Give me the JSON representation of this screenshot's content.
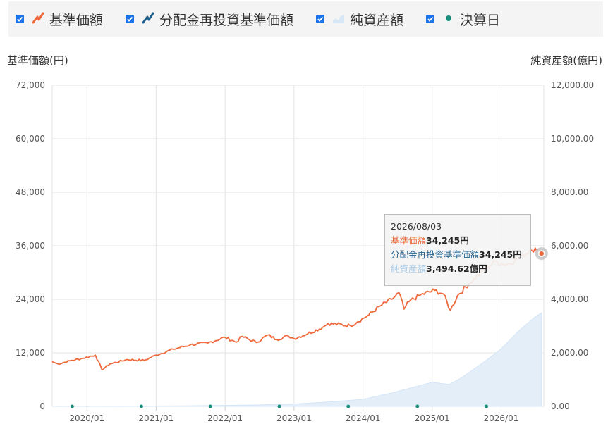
{
  "legend": [
    {
      "label": "基準価額",
      "icon": "nav-line-icon",
      "color": "#ee6a3c",
      "checked": true
    },
    {
      "label": "分配金再投資基準価額",
      "icon": "reinvest-line-icon",
      "color": "#1f5f8b",
      "checked": true
    },
    {
      "label": "純資産額",
      "icon": "area-icon",
      "color": "#c9dff2",
      "checked": true
    },
    {
      "label": "決算日",
      "icon": "dot-icon",
      "color": "#1a8f7e",
      "checked": true
    }
  ],
  "axis_titles": {
    "left": "基準価額(円)",
    "right": "純資産額(億円)"
  },
  "tooltip": {
    "date": "2026/08/03",
    "rows": [
      {
        "label": "基準価額",
        "value": "34,245円",
        "color": "#ee6a3c"
      },
      {
        "label": "分配金再投資基準価額",
        "value": "34,245円",
        "color": "#1f5f8b"
      },
      {
        "label": "純資産額",
        "value": "3,494.62億円",
        "color": "#a9cbe8"
      }
    ]
  },
  "chart_data": {
    "type": "line",
    "x_ticks": [
      "2020/01",
      "2021/01",
      "2022/01",
      "2023/01",
      "2024/01",
      "2025/01",
      "2026/01"
    ],
    "y_left": {
      "ticks": [
        "0",
        "12,000",
        "24,000",
        "36,000",
        "48,000",
        "60,000",
        "72,000"
      ],
      "range": [
        0,
        72000
      ]
    },
    "y_right": {
      "ticks": [
        "0.00",
        "2,000.00",
        "4,000.00",
        "6,000.00",
        "8,000.00",
        "10,000.00",
        "12,000.00"
      ],
      "range": [
        0,
        12000
      ]
    },
    "x_range": [
      "2019-07-01",
      "2026-08-15"
    ],
    "grid": true,
    "series": [
      {
        "name": "基準価額",
        "axis": "left",
        "color": "#ee6a3c",
        "points": [
          [
            "2019-07-01",
            10000
          ],
          [
            "2019-08-01",
            9500
          ],
          [
            "2019-10-01",
            10200
          ],
          [
            "2019-12-01",
            10700
          ],
          [
            "2020-02-15",
            11500
          ],
          [
            "2020-03-20",
            8200
          ],
          [
            "2020-05-01",
            9500
          ],
          [
            "2020-08-01",
            10500
          ],
          [
            "2020-10-30",
            10300
          ],
          [
            "2021-01-01",
            11500
          ],
          [
            "2021-04-01",
            12800
          ],
          [
            "2021-07-01",
            13800
          ],
          [
            "2021-10-01",
            14200
          ],
          [
            "2022-01-01",
            15500
          ],
          [
            "2022-03-01",
            14400
          ],
          [
            "2022-04-01",
            15700
          ],
          [
            "2022-06-15",
            14300
          ],
          [
            "2022-08-15",
            16000
          ],
          [
            "2022-10-01",
            15000
          ],
          [
            "2022-12-01",
            15800
          ],
          [
            "2023-01-01",
            15200
          ],
          [
            "2023-03-15",
            16300
          ],
          [
            "2023-06-01",
            17700
          ],
          [
            "2023-07-01",
            18600
          ],
          [
            "2023-10-25",
            18100
          ],
          [
            "2023-12-01",
            18900
          ],
          [
            "2024-02-01",
            20500
          ],
          [
            "2024-04-01",
            22500
          ],
          [
            "2024-06-01",
            24000
          ],
          [
            "2024-07-10",
            25500
          ],
          [
            "2024-08-05",
            21800
          ],
          [
            "2024-09-01",
            23500
          ],
          [
            "2024-11-01",
            25000
          ],
          [
            "2025-01-15",
            26000
          ],
          [
            "2025-03-01",
            25200
          ],
          [
            "2025-04-08",
            21500
          ],
          [
            "2025-05-15",
            24800
          ],
          [
            "2025-07-15",
            27500
          ],
          [
            "2025-10-01",
            30500
          ],
          [
            "2025-12-01",
            32500
          ],
          [
            "2026-02-01",
            31800
          ],
          [
            "2026-04-15",
            33500
          ],
          [
            "2026-06-01",
            35000
          ],
          [
            "2026-07-01",
            35500
          ],
          [
            "2026-08-03",
            34245
          ]
        ]
      },
      {
        "name": "純資産額",
        "axis": "right",
        "color": "#e3eef9",
        "points": [
          [
            "2019-07-01",
            0
          ],
          [
            "2020-06-01",
            5
          ],
          [
            "2021-06-01",
            20
          ],
          [
            "2022-06-01",
            50
          ],
          [
            "2023-01-01",
            90
          ],
          [
            "2023-06-01",
            150
          ],
          [
            "2024-01-01",
            260
          ],
          [
            "2024-06-01",
            500
          ],
          [
            "2025-01-01",
            900
          ],
          [
            "2025-04-01",
            820
          ],
          [
            "2025-06-01",
            1050
          ],
          [
            "2025-10-01",
            1650
          ],
          [
            "2026-01-01",
            2150
          ],
          [
            "2026-04-01",
            2800
          ],
          [
            "2026-07-01",
            3350
          ],
          [
            "2026-08-03",
            3494.62
          ]
        ]
      }
    ],
    "settlement_dates": [
      "2019-10-15",
      "2020-10-15",
      "2021-10-15",
      "2022-10-15",
      "2023-10-15",
      "2024-10-15",
      "2025-10-15"
    ],
    "highlight": {
      "date": "2026-08-03",
      "value": 34245
    }
  }
}
